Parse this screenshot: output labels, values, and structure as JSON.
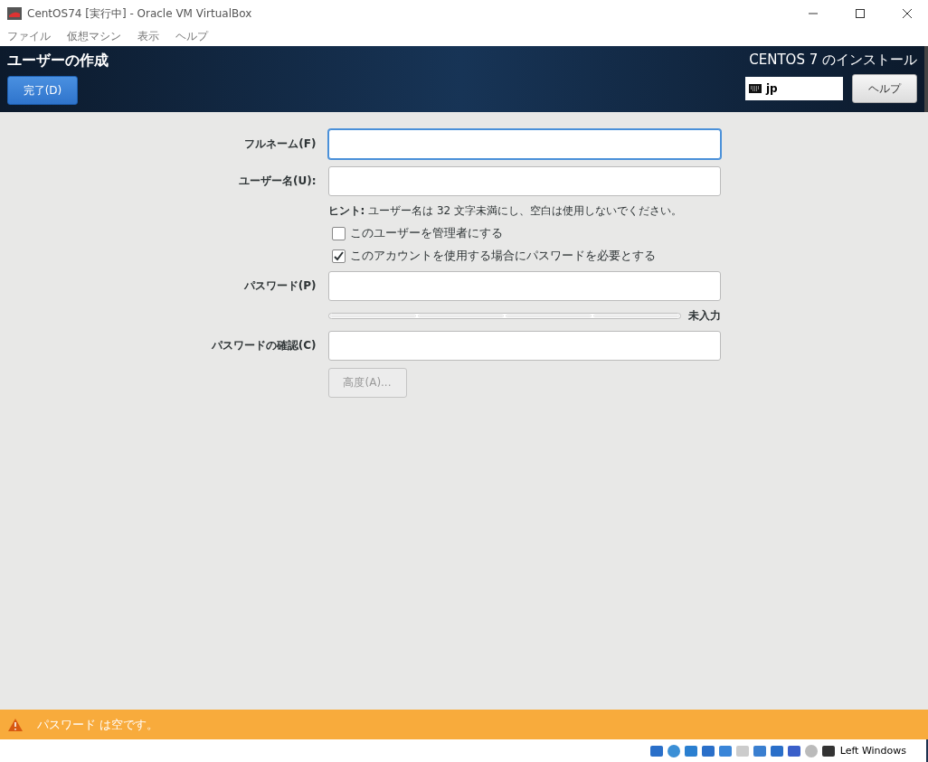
{
  "window": {
    "title": "CentOS74 [実行中] - Oracle VM VirtualBox"
  },
  "menu": [
    "ファイル",
    "仮想マシン",
    "表示",
    "ヘルプ"
  ],
  "header": {
    "title": "ユーザーの作成",
    "done_button": "完了(D)",
    "product": "CENTOS 7 のインストール",
    "keyboard": "jp",
    "help_button": "ヘルプ"
  },
  "form": {
    "fields": [
      {
        "label": "フルネーム(F)",
        "focused": true
      },
      {
        "label": "ユーザー名(U):",
        "focused": false
      }
    ],
    "hint_label": "ヒント:",
    "hint": "ユーザー名は 32 文字未満にし、空白は使用しないでください。",
    "checkboxes": [
      {
        "label": "このユーザーを管理者にする",
        "checked": false
      },
      {
        "label": "このアカウントを使用する場合にパスワードを必要とする",
        "checked": true
      }
    ],
    "password": {
      "label": "パスワード(P)",
      "focused": false,
      "strength": {
        "text": "未入力"
      }
    },
    "confirm": {
      "label": "パスワードの確認(C)",
      "focused": false
    },
    "advanced_button": {
      "label": "高度(A)...",
      "disabled": true
    }
  },
  "warning": {
    "text": "パスワード は空です。"
  },
  "status_bar": {
    "host_key": "Left Windows"
  }
}
